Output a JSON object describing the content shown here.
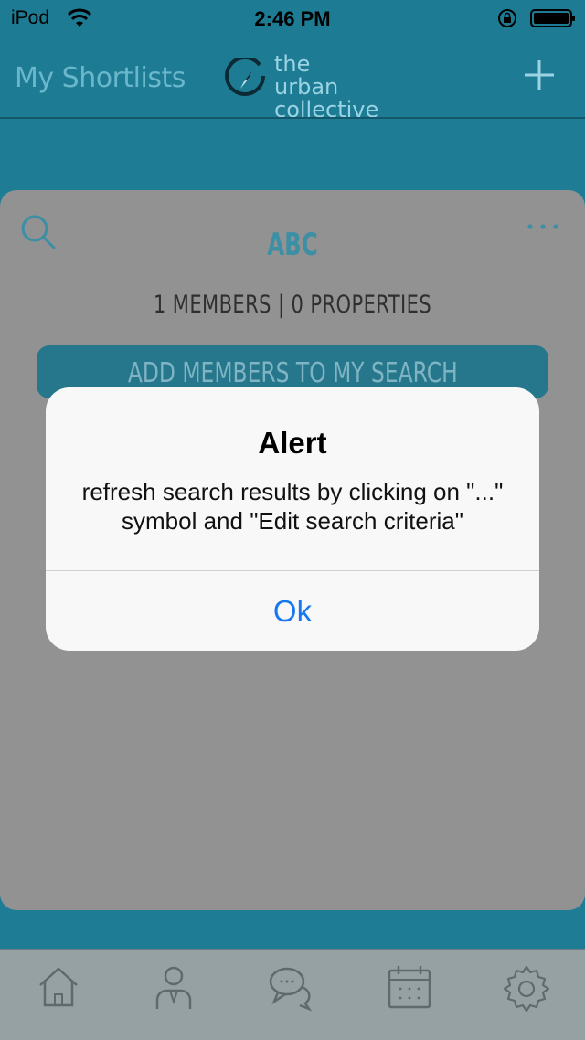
{
  "status_bar": {
    "carrier": "iPod",
    "time": "2:46 PM"
  },
  "navbar": {
    "title": "My Shortlists",
    "logo_line1": "the urban",
    "logo_line2": "collective"
  },
  "card": {
    "title": "ABC",
    "meta": "1 MEMBERS | 0 PROPERTIES",
    "add_members_label": "ADD MEMBERS TO MY SEARCH"
  },
  "alert": {
    "title": "Alert",
    "message": "refresh search results by clicking on \"...\" symbol and \"Edit search criteria\"",
    "ok_label": "Ok"
  },
  "tabbar": {
    "icons": [
      "home-icon",
      "profile-icon",
      "chat-icon",
      "calendar-icon",
      "settings-icon"
    ]
  },
  "colors": {
    "accent": "#1d7b93",
    "alert_button": "#1777f2",
    "card_overlay": "#929292"
  }
}
